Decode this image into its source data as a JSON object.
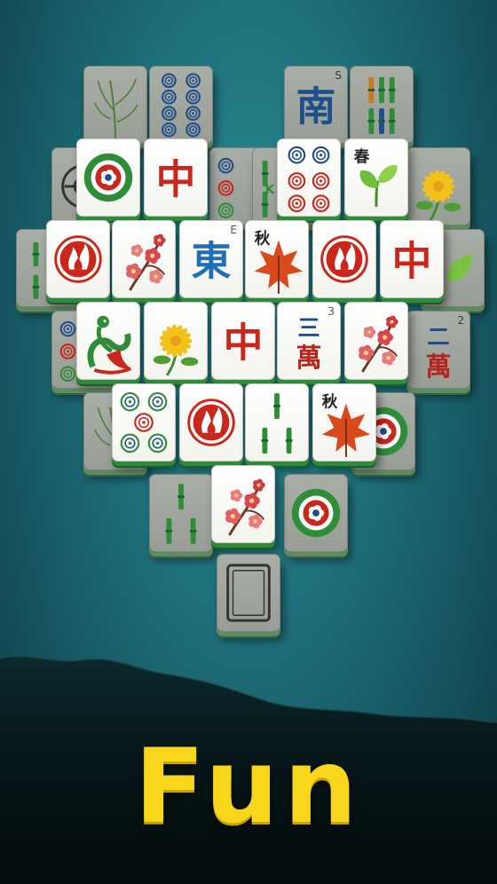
{
  "caption": "Fun",
  "tiles": [
    {
      "id": "t01",
      "kind": "bamboo-plant",
      "dim": true
    },
    {
      "id": "t02",
      "kind": "dots-8",
      "dim": true
    },
    {
      "id": "t03",
      "kind": "char",
      "text": "南",
      "color": "#1f4f8a",
      "corner": "S",
      "dim": true
    },
    {
      "id": "t04",
      "kind": "bamboo-stripes",
      "dim": true
    },
    {
      "id": "t05",
      "kind": "wheel",
      "dim": true
    },
    {
      "id": "t06",
      "kind": "medallion",
      "dim": false
    },
    {
      "id": "t07",
      "kind": "char",
      "text": "中",
      "color": "#c9261c",
      "dim": false
    },
    {
      "id": "t08",
      "kind": "dots-partial",
      "dim": true
    },
    {
      "id": "t09",
      "kind": "bamboo-edge",
      "dim": true
    },
    {
      "id": "t10",
      "kind": "dots-6",
      "dim": false
    },
    {
      "id": "t11",
      "kind": "spring",
      "text": "春",
      "dim": false
    },
    {
      "id": "t12",
      "kind": "yellow-flower",
      "dim": true
    },
    {
      "id": "t13",
      "kind": "bamboo-2",
      "dim": true
    },
    {
      "id": "t14",
      "kind": "fire",
      "dim": false
    },
    {
      "id": "t15",
      "kind": "plum",
      "dim": false
    },
    {
      "id": "t16",
      "kind": "char",
      "text": "東",
      "color": "#1f6fb5",
      "corner": "E",
      "dim": false
    },
    {
      "id": "t17",
      "kind": "autumn",
      "text": "秋",
      "dim": false
    },
    {
      "id": "t18",
      "kind": "fire",
      "dim": false
    },
    {
      "id": "t19",
      "kind": "char",
      "text": "中",
      "color": "#c9261c",
      "dim": false
    },
    {
      "id": "t20",
      "kind": "leaf-edge",
      "dim": true
    },
    {
      "id": "t21",
      "kind": "dots-partial",
      "dim": true
    },
    {
      "id": "t22",
      "kind": "peacock",
      "dim": false
    },
    {
      "id": "t23",
      "kind": "chrysanthemum",
      "dim": false
    },
    {
      "id": "t24",
      "kind": "char",
      "text": "中",
      "color": "#c9261c",
      "dim": false
    },
    {
      "id": "t25",
      "kind": "wan",
      "text": "三",
      "sub": "萬",
      "corner": "3",
      "dim": false
    },
    {
      "id": "t26",
      "kind": "plum",
      "dim": false
    },
    {
      "id": "t27",
      "kind": "wan",
      "text": "二",
      "sub": "萬",
      "corner": "2",
      "dim": true
    },
    {
      "id": "t28",
      "kind": "bamboo-plant",
      "dim": true
    },
    {
      "id": "t29",
      "kind": "dots-5",
      "dim": false
    },
    {
      "id": "t30",
      "kind": "fire",
      "dim": false
    },
    {
      "id": "t31",
      "kind": "bamboo-3",
      "dim": false
    },
    {
      "id": "t32",
      "kind": "autumn",
      "text": "秋",
      "dim": false
    },
    {
      "id": "t33",
      "kind": "medallion-edge",
      "dim": true
    },
    {
      "id": "t34",
      "kind": "bamboo-3",
      "dim": true
    },
    {
      "id": "t35",
      "kind": "plum",
      "dim": false
    },
    {
      "id": "t36",
      "kind": "medallion",
      "dim": true
    },
    {
      "id": "t37",
      "kind": "blank-frame",
      "dim": true
    }
  ]
}
